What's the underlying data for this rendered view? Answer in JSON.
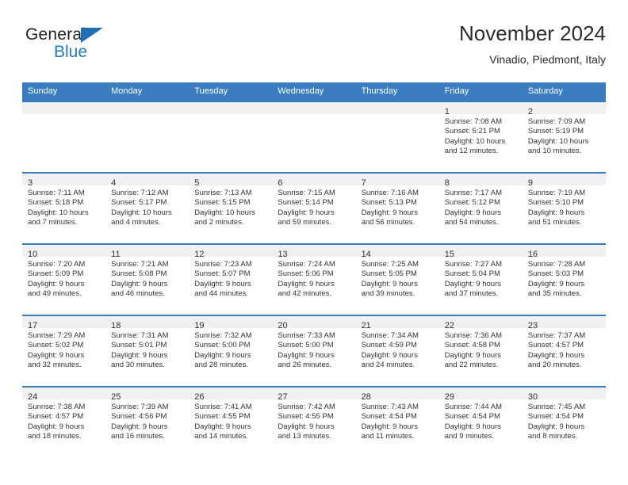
{
  "brand": {
    "word1": "General",
    "word2": "Blue",
    "triangle_color": "#1f6fb5",
    "blue_text_color": "#1f7ac0"
  },
  "header": {
    "title": "November 2024",
    "subtitle": "Vinadio, Piedmont, Italy"
  },
  "theme": {
    "header_blue": "#3a7dc0",
    "day_band_gray": "#f0f0f0",
    "text_color": "#333333"
  },
  "weekdays": [
    "Sunday",
    "Monday",
    "Tuesday",
    "Wednesday",
    "Thursday",
    "Friday",
    "Saturday"
  ],
  "weeks": [
    [
      {
        "day": "",
        "sunrise": "",
        "sunset": "",
        "daylight1": "",
        "daylight2": ""
      },
      {
        "day": "",
        "sunrise": "",
        "sunset": "",
        "daylight1": "",
        "daylight2": ""
      },
      {
        "day": "",
        "sunrise": "",
        "sunset": "",
        "daylight1": "",
        "daylight2": ""
      },
      {
        "day": "",
        "sunrise": "",
        "sunset": "",
        "daylight1": "",
        "daylight2": ""
      },
      {
        "day": "",
        "sunrise": "",
        "sunset": "",
        "daylight1": "",
        "daylight2": ""
      },
      {
        "day": "1",
        "sunrise": "Sunrise: 7:08 AM",
        "sunset": "Sunset: 5:21 PM",
        "daylight1": "Daylight: 10 hours",
        "daylight2": "and 12 minutes."
      },
      {
        "day": "2",
        "sunrise": "Sunrise: 7:09 AM",
        "sunset": "Sunset: 5:19 PM",
        "daylight1": "Daylight: 10 hours",
        "daylight2": "and 10 minutes."
      }
    ],
    [
      {
        "day": "3",
        "sunrise": "Sunrise: 7:11 AM",
        "sunset": "Sunset: 5:18 PM",
        "daylight1": "Daylight: 10 hours",
        "daylight2": "and 7 minutes."
      },
      {
        "day": "4",
        "sunrise": "Sunrise: 7:12 AM",
        "sunset": "Sunset: 5:17 PM",
        "daylight1": "Daylight: 10 hours",
        "daylight2": "and 4 minutes."
      },
      {
        "day": "5",
        "sunrise": "Sunrise: 7:13 AM",
        "sunset": "Sunset: 5:15 PM",
        "daylight1": "Daylight: 10 hours",
        "daylight2": "and 2 minutes."
      },
      {
        "day": "6",
        "sunrise": "Sunrise: 7:15 AM",
        "sunset": "Sunset: 5:14 PM",
        "daylight1": "Daylight: 9 hours",
        "daylight2": "and 59 minutes."
      },
      {
        "day": "7",
        "sunrise": "Sunrise: 7:16 AM",
        "sunset": "Sunset: 5:13 PM",
        "daylight1": "Daylight: 9 hours",
        "daylight2": "and 56 minutes."
      },
      {
        "day": "8",
        "sunrise": "Sunrise: 7:17 AM",
        "sunset": "Sunset: 5:12 PM",
        "daylight1": "Daylight: 9 hours",
        "daylight2": "and 54 minutes."
      },
      {
        "day": "9",
        "sunrise": "Sunrise: 7:19 AM",
        "sunset": "Sunset: 5:10 PM",
        "daylight1": "Daylight: 9 hours",
        "daylight2": "and 51 minutes."
      }
    ],
    [
      {
        "day": "10",
        "sunrise": "Sunrise: 7:20 AM",
        "sunset": "Sunset: 5:09 PM",
        "daylight1": "Daylight: 9 hours",
        "daylight2": "and 49 minutes."
      },
      {
        "day": "11",
        "sunrise": "Sunrise: 7:21 AM",
        "sunset": "Sunset: 5:08 PM",
        "daylight1": "Daylight: 9 hours",
        "daylight2": "and 46 minutes."
      },
      {
        "day": "12",
        "sunrise": "Sunrise: 7:23 AM",
        "sunset": "Sunset: 5:07 PM",
        "daylight1": "Daylight: 9 hours",
        "daylight2": "and 44 minutes."
      },
      {
        "day": "13",
        "sunrise": "Sunrise: 7:24 AM",
        "sunset": "Sunset: 5:06 PM",
        "daylight1": "Daylight: 9 hours",
        "daylight2": "and 42 minutes."
      },
      {
        "day": "14",
        "sunrise": "Sunrise: 7:25 AM",
        "sunset": "Sunset: 5:05 PM",
        "daylight1": "Daylight: 9 hours",
        "daylight2": "and 39 minutes."
      },
      {
        "day": "15",
        "sunrise": "Sunrise: 7:27 AM",
        "sunset": "Sunset: 5:04 PM",
        "daylight1": "Daylight: 9 hours",
        "daylight2": "and 37 minutes."
      },
      {
        "day": "16",
        "sunrise": "Sunrise: 7:28 AM",
        "sunset": "Sunset: 5:03 PM",
        "daylight1": "Daylight: 9 hours",
        "daylight2": "and 35 minutes."
      }
    ],
    [
      {
        "day": "17",
        "sunrise": "Sunrise: 7:29 AM",
        "sunset": "Sunset: 5:02 PM",
        "daylight1": "Daylight: 9 hours",
        "daylight2": "and 32 minutes."
      },
      {
        "day": "18",
        "sunrise": "Sunrise: 7:31 AM",
        "sunset": "Sunset: 5:01 PM",
        "daylight1": "Daylight: 9 hours",
        "daylight2": "and 30 minutes."
      },
      {
        "day": "19",
        "sunrise": "Sunrise: 7:32 AM",
        "sunset": "Sunset: 5:00 PM",
        "daylight1": "Daylight: 9 hours",
        "daylight2": "and 28 minutes."
      },
      {
        "day": "20",
        "sunrise": "Sunrise: 7:33 AM",
        "sunset": "Sunset: 5:00 PM",
        "daylight1": "Daylight: 9 hours",
        "daylight2": "and 26 minutes."
      },
      {
        "day": "21",
        "sunrise": "Sunrise: 7:34 AM",
        "sunset": "Sunset: 4:59 PM",
        "daylight1": "Daylight: 9 hours",
        "daylight2": "and 24 minutes."
      },
      {
        "day": "22",
        "sunrise": "Sunrise: 7:36 AM",
        "sunset": "Sunset: 4:58 PM",
        "daylight1": "Daylight: 9 hours",
        "daylight2": "and 22 minutes."
      },
      {
        "day": "23",
        "sunrise": "Sunrise: 7:37 AM",
        "sunset": "Sunset: 4:57 PM",
        "daylight1": "Daylight: 9 hours",
        "daylight2": "and 20 minutes."
      }
    ],
    [
      {
        "day": "24",
        "sunrise": "Sunrise: 7:38 AM",
        "sunset": "Sunset: 4:57 PM",
        "daylight1": "Daylight: 9 hours",
        "daylight2": "and 18 minutes."
      },
      {
        "day": "25",
        "sunrise": "Sunrise: 7:39 AM",
        "sunset": "Sunset: 4:56 PM",
        "daylight1": "Daylight: 9 hours",
        "daylight2": "and 16 minutes."
      },
      {
        "day": "26",
        "sunrise": "Sunrise: 7:41 AM",
        "sunset": "Sunset: 4:55 PM",
        "daylight1": "Daylight: 9 hours",
        "daylight2": "and 14 minutes."
      },
      {
        "day": "27",
        "sunrise": "Sunrise: 7:42 AM",
        "sunset": "Sunset: 4:55 PM",
        "daylight1": "Daylight: 9 hours",
        "daylight2": "and 13 minutes."
      },
      {
        "day": "28",
        "sunrise": "Sunrise: 7:43 AM",
        "sunset": "Sunset: 4:54 PM",
        "daylight1": "Daylight: 9 hours",
        "daylight2": "and 11 minutes."
      },
      {
        "day": "29",
        "sunrise": "Sunrise: 7:44 AM",
        "sunset": "Sunset: 4:54 PM",
        "daylight1": "Daylight: 9 hours",
        "daylight2": "and 9 minutes."
      },
      {
        "day": "30",
        "sunrise": "Sunrise: 7:45 AM",
        "sunset": "Sunset: 4:54 PM",
        "daylight1": "Daylight: 9 hours",
        "daylight2": "and 8 minutes."
      }
    ]
  ]
}
